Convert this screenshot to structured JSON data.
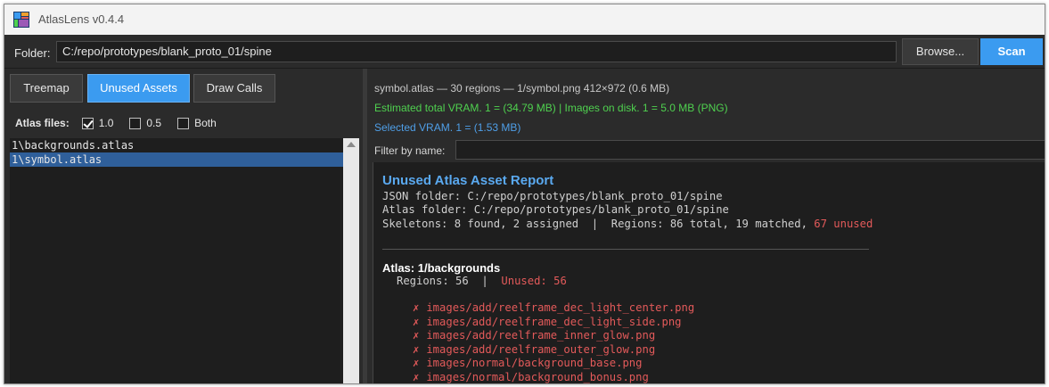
{
  "app": {
    "title": "AtlasLens v0.4.4"
  },
  "toolbar": {
    "folder_label": "Folder:",
    "folder_value": "C:/repo/prototypes/blank_proto_01/spine",
    "browse_label": "Browse...",
    "scan_label": "Scan"
  },
  "tabs": [
    {
      "label": "Treemap",
      "active": false
    },
    {
      "label": "Unused Assets",
      "active": true
    },
    {
      "label": "Draw Calls",
      "active": false
    }
  ],
  "atlas_files": {
    "label": "Atlas files:",
    "options": [
      {
        "label": "1.0",
        "checked": true
      },
      {
        "label": "0.5",
        "checked": false
      },
      {
        "label": "Both",
        "checked": false
      }
    ]
  },
  "file_list": [
    {
      "label": "1\\backgrounds.atlas",
      "selected": false
    },
    {
      "label": "1\\symbol.atlas",
      "selected": true
    }
  ],
  "info": {
    "summary": "symbol.atlas — 30 regions — 1/symbol.png 412×972 (0.6 MB)",
    "vram": "Estimated total VRAM. 1 = (34.79 MB)  |  Images on disk. 1 = 5.0 MB (PNG)",
    "selected_vram": "Selected VRAM. 1 = (1.53 MB)"
  },
  "filter": {
    "label": "Filter by name:",
    "value": ""
  },
  "report": {
    "title": "Unused Atlas Asset Report",
    "json_folder": "JSON folder: C:/repo/prototypes/blank_proto_01/spine",
    "atlas_folder": "Atlas folder: C:/repo/prototypes/blank_proto_01/spine",
    "skeletons_prefix": "Skeletons: 8 found, 2 assigned  |  Regions: 86 total, 19 matched, ",
    "unused_count": "67 unused",
    "atlas_heading": "Atlas: 1/backgrounds",
    "regions_prefix": "Regions: 56  |  ",
    "regions_unused": "Unused: 56",
    "missing": [
      "images/add/reelframe_dec_light_center.png",
      "images/add/reelframe_dec_light_side.png",
      "images/add/reelframe_inner_glow.png",
      "images/add/reelframe_outer_glow.png",
      "images/normal/background_base.png",
      "images/normal/background_bonus.png"
    ]
  },
  "colors": {
    "accent": "#3b9bf0",
    "green": "#4fd14f",
    "blue_text": "#4f9fe8",
    "red": "#e35a5a"
  }
}
